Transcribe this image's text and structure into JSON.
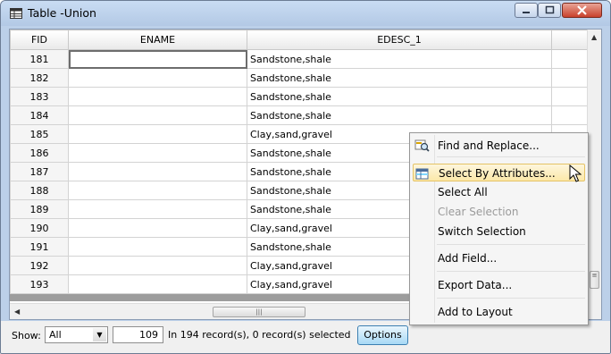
{
  "window": {
    "title": "Table -Union"
  },
  "table": {
    "columns": [
      "FID",
      "ENAME",
      "EDESC_1"
    ],
    "rows": [
      {
        "fid": "181",
        "ename": "",
        "edesc": "Sandstone,shale"
      },
      {
        "fid": "182",
        "ename": "",
        "edesc": "Sandstone,shale"
      },
      {
        "fid": "183",
        "ename": "",
        "edesc": "Sandstone,shale"
      },
      {
        "fid": "184",
        "ename": "",
        "edesc": "Sandstone,shale"
      },
      {
        "fid": "185",
        "ename": "",
        "edesc": "Clay,sand,gravel"
      },
      {
        "fid": "186",
        "ename": "",
        "edesc": "Sandstone,shale"
      },
      {
        "fid": "187",
        "ename": "",
        "edesc": "Sandstone,shale"
      },
      {
        "fid": "188",
        "ename": "",
        "edesc": "Sandstone,shale"
      },
      {
        "fid": "189",
        "ename": "",
        "edesc": "Sandstone,shale"
      },
      {
        "fid": "190",
        "ename": "",
        "edesc": "Clay,sand,gravel"
      },
      {
        "fid": "191",
        "ename": "",
        "edesc": "Sandstone,shale"
      },
      {
        "fid": "192",
        "ename": "",
        "edesc": "Clay,sand,gravel"
      },
      {
        "fid": "193",
        "ename": "",
        "edesc": "Clay,sand,gravel"
      }
    ]
  },
  "statusbar": {
    "show_label": "Show:",
    "show_value": "All",
    "current_record": "109",
    "record_info": "In 194 record(s), 0 record(s) selected",
    "options_label": "Options"
  },
  "context_menu": {
    "items": [
      {
        "label": "Find and Replace...",
        "icon": "find-replace-icon",
        "disabled": false,
        "highlighted": false
      },
      {
        "label": "Select By Attributes...",
        "icon": "select-by-attributes-icon",
        "disabled": false,
        "highlighted": true
      },
      {
        "label": "Select All",
        "disabled": false,
        "highlighted": false
      },
      {
        "label": "Clear Selection",
        "disabled": true,
        "highlighted": false
      },
      {
        "label": "Switch Selection",
        "disabled": false,
        "highlighted": false
      },
      {
        "label": "Add Field...",
        "disabled": false,
        "highlighted": false
      },
      {
        "label": "Export Data...",
        "disabled": false,
        "highlighted": false
      },
      {
        "label": "Add to Layout",
        "disabled": false,
        "highlighted": false
      }
    ]
  },
  "colors": {
    "title_bar": "#c0d4ed",
    "menu_highlight": "#fce8a9",
    "options_button": "#a7d9f5"
  }
}
